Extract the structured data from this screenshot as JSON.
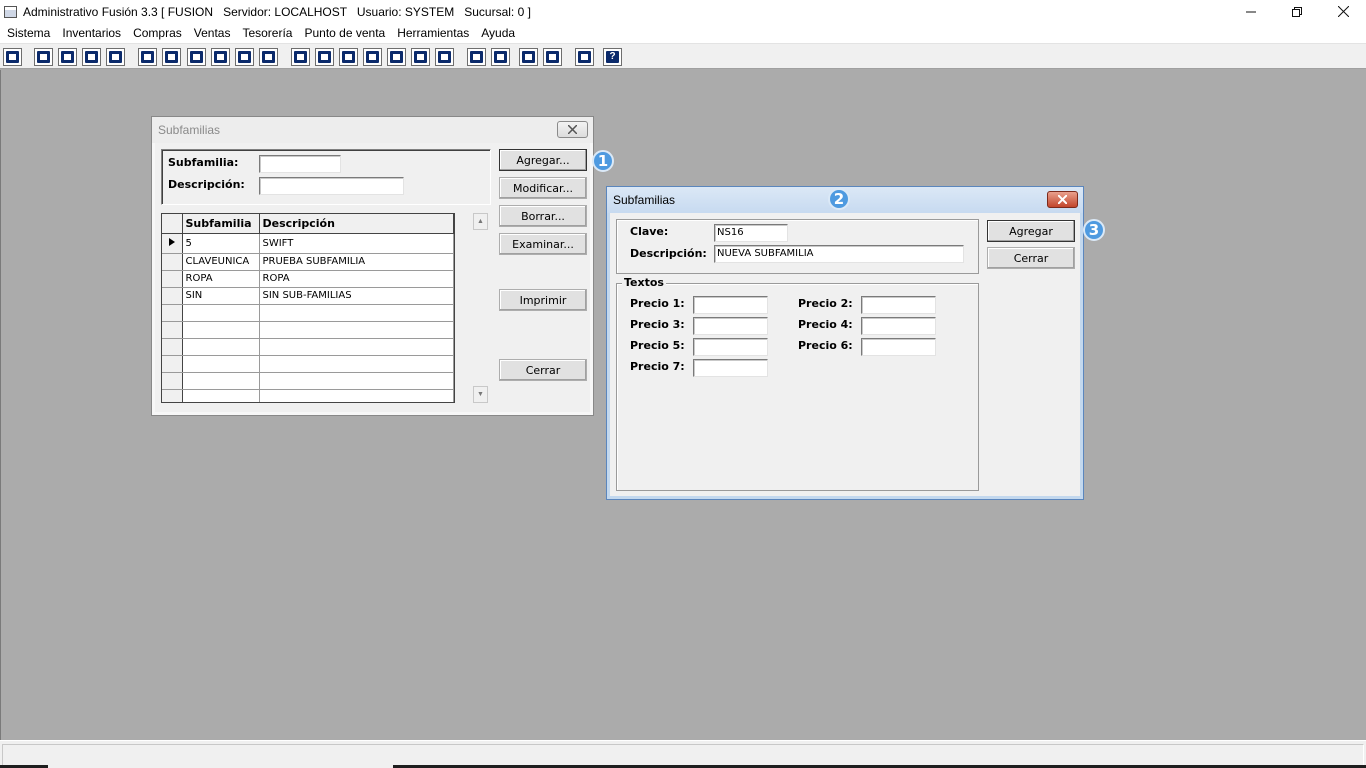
{
  "app": {
    "title": "Administrativo Fusión 3.3 [ FUSION   Servidor: LOCALHOST   Usuario: SYSTEM   Sucursal: 0 ]"
  },
  "menu": [
    "Sistema",
    "Inventarios",
    "Compras",
    "Ventas",
    "Tesorería",
    "Punto de venta",
    "Herramientas",
    "Ayuda"
  ],
  "toolbar_icons": [
    "calculator-icon",
    "copy-icon",
    "clipboard-icon",
    "transfer-icon",
    "search-icon",
    "user-icon",
    "folder-icon",
    "import-icon",
    "printer-icon",
    "document-icon",
    "list-icon",
    "columns-icon",
    "box-icon",
    "export-icon",
    "add-icon",
    "dollar-icon",
    "report-icon",
    "table-icon",
    "home-icon",
    "zoom-icon",
    "refresh-icon",
    "undo-icon",
    "back-arrow-icon",
    "help-icon"
  ],
  "subfamilias_list": {
    "title": "Subfamilias",
    "subfamilia_label": "Subfamilia:",
    "descripcion_label": "Descripción:",
    "subfamilia_value": "",
    "descripcion_value": "",
    "columns": [
      "Subfamilia",
      "Descripción"
    ],
    "rows": [
      {
        "subfamilia": "5",
        "descripcion": "SWIFT"
      },
      {
        "subfamilia": "CLAVEUNICA",
        "descripcion": "PRUEBA SUBFAMILIA"
      },
      {
        "subfamilia": "ROPA",
        "descripcion": "ROPA"
      },
      {
        "subfamilia": "SIN",
        "descripcion": "SIN SUB-FAMILIAS"
      },
      {
        "subfamilia": "",
        "descripcion": ""
      },
      {
        "subfamilia": "",
        "descripcion": ""
      },
      {
        "subfamilia": "",
        "descripcion": ""
      },
      {
        "subfamilia": "",
        "descripcion": ""
      },
      {
        "subfamilia": "",
        "descripcion": ""
      },
      {
        "subfamilia": "",
        "descripcion": ""
      }
    ],
    "buttons": {
      "agregar": "Agregar...",
      "modificar": "Modificar...",
      "borrar": "Borrar...",
      "examinar": "Examinar...",
      "imprimir": "Imprimir",
      "cerrar": "Cerrar"
    }
  },
  "subfamilias_edit": {
    "title": "Subfamilias",
    "clave_label": "Clave:",
    "clave_value": "NS16",
    "descripcion_label": "Descripción:",
    "descripcion_value": "NUEVA SUBFAMILIA",
    "textos_label": "Textos",
    "precios": [
      {
        "label": "Precio 1:",
        "value": ""
      },
      {
        "label": "Precio 2:",
        "value": ""
      },
      {
        "label": "Precio 3:",
        "value": ""
      },
      {
        "label": "Precio 4:",
        "value": ""
      },
      {
        "label": "Precio 5:",
        "value": ""
      },
      {
        "label": "Precio 6:",
        "value": ""
      },
      {
        "label": "Precio 7:",
        "value": ""
      }
    ],
    "buttons": {
      "agregar": "Agregar",
      "cerrar": "Cerrar"
    }
  },
  "badges": [
    "1",
    "2",
    "3"
  ],
  "colors": {
    "badge": "#4e9ae0",
    "desktop": "#ababab",
    "close_button": "#c2462c"
  }
}
